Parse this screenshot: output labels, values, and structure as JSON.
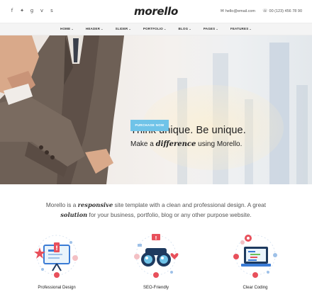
{
  "topbar": {
    "social_icons": [
      "facebook-icon",
      "twitter-icon",
      "google-plus-icon",
      "vimeo-icon",
      "skype-icon"
    ],
    "social_glyphs": [
      "f",
      "🐦",
      "g",
      "v",
      "s"
    ],
    "logo": "morello",
    "email": "hello@email.com",
    "phone": "00 (123) 456 78 90"
  },
  "nav": {
    "items": [
      "HOME",
      "HEADER",
      "SLIDER",
      "PORTFOLIO",
      "BLOG",
      "PAGES",
      "FEATURES"
    ]
  },
  "hero": {
    "headline": "Think unique. Be unique.",
    "sub_before": "Make a ",
    "sub_em": "difference",
    "sub_after": " using Morello.",
    "button": "PURCHASE NOW"
  },
  "intro": {
    "part1": "Morello is a ",
    "em1": "responsive",
    "part2": " site template with a clean and professional design. A great",
    "em2": "solution",
    "part3": " for your business, portfolio, blog or any other purpose website."
  },
  "features": [
    {
      "label": "Professional Design",
      "icon": "design-board-icon"
    },
    {
      "label": "SEO-Friendly",
      "icon": "binoculars-icon"
    },
    {
      "label": "Clear Coding",
      "icon": "laptop-code-icon"
    }
  ],
  "colors": {
    "accent": "#6fc3e8",
    "icon_blue": "#3a7bd5",
    "icon_red": "#e8505b",
    "icon_navy": "#1e3a5f"
  }
}
